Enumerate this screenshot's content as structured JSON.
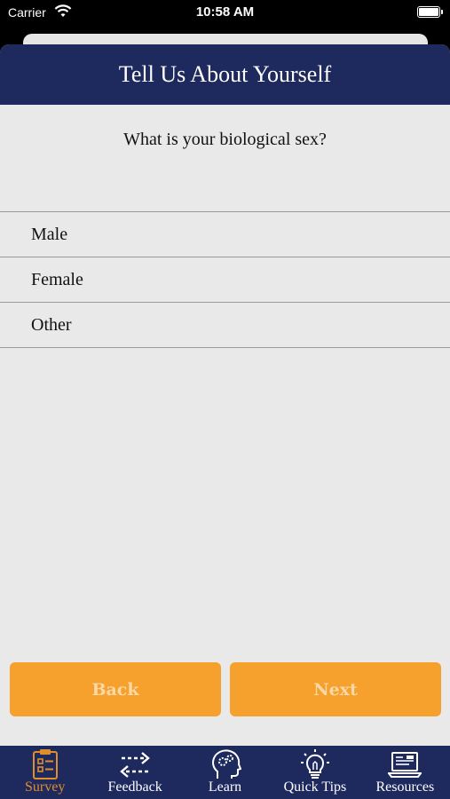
{
  "status_bar": {
    "carrier": "Carrier",
    "time": "10:58 AM"
  },
  "header": {
    "title": "Tell Us About Yourself"
  },
  "question": "What is your biological sex?",
  "options": [
    "Male",
    "Female",
    "Other"
  ],
  "buttons": {
    "back": "Back",
    "next": "Next"
  },
  "tabs": [
    {
      "label": "Survey",
      "icon": "clipboard-icon",
      "active": true
    },
    {
      "label": "Feedback",
      "icon": "arrows-exchange-icon",
      "active": false
    },
    {
      "label": "Learn",
      "icon": "head-gears-icon",
      "active": false
    },
    {
      "label": "Quick Tips",
      "icon": "lightbulb-icon",
      "active": false
    },
    {
      "label": "Resources",
      "icon": "laptop-icon",
      "active": false
    }
  ],
  "colors": {
    "header": "#1e2a5e",
    "accent": "#f6a02d",
    "active_tab": "#e08e2a",
    "background": "#e9e9e9"
  }
}
